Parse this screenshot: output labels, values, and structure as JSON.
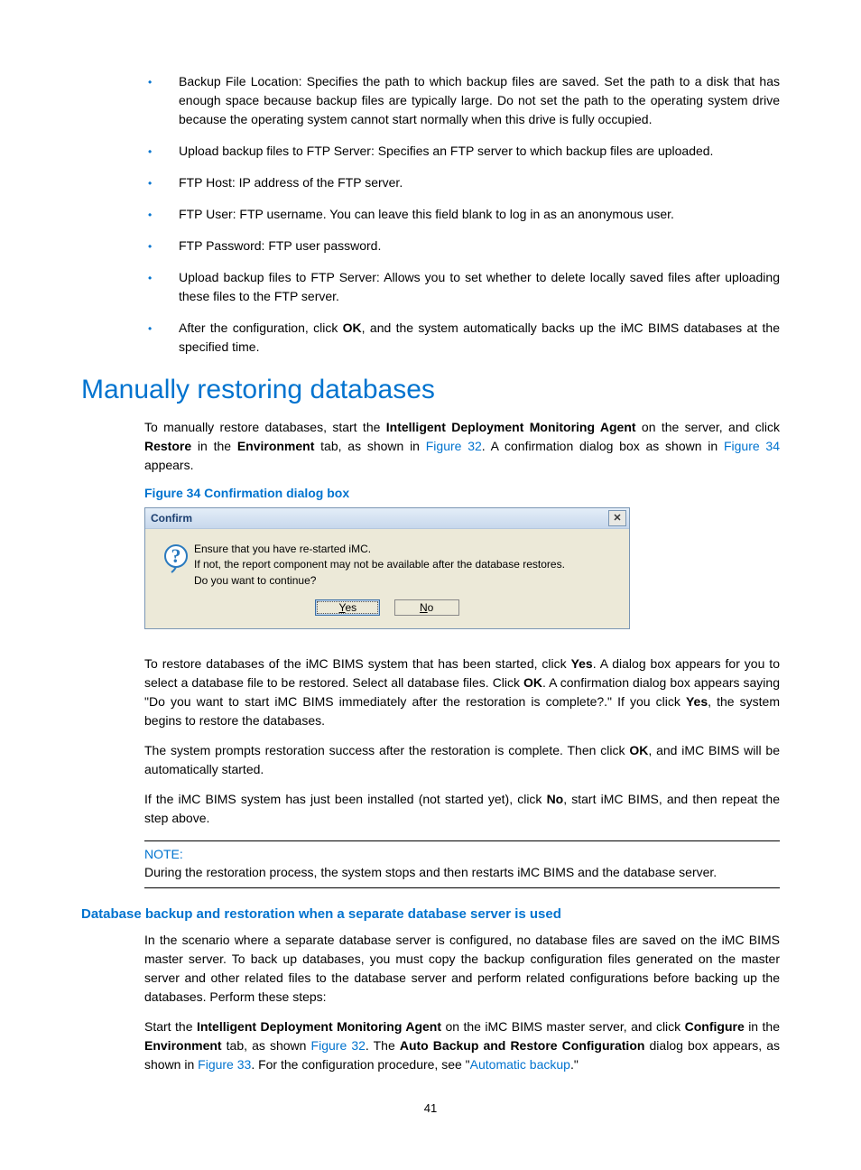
{
  "bullets": [
    "Backup File Location: Specifies the path to which backup files are saved. Set the path to a disk that has enough space because backup files are typically large. Do not set the path to the operating system drive because the operating system cannot start normally when this drive is fully occupied.",
    "Upload backup files to FTP Server: Specifies an FTP server to which backup files are uploaded.",
    "FTP Host: IP address of the FTP server.",
    "FTP User: FTP username. You can leave this field blank to log in as an anonymous user.",
    "FTP Password: FTP user password.",
    "Upload backup files to FTP Server: Allows you to set whether to delete locally saved files after uploading these files to the FTP server."
  ],
  "bullet_last": {
    "pre": "After the configuration, click ",
    "bold": "OK",
    "post": ", and the system automatically backs up the iMC BIMS databases at the specified time."
  },
  "h1": "Manually restoring databases",
  "intro": {
    "pre": "To manually restore databases, start the ",
    "b1": "Intelligent Deployment Monitoring Agent",
    "mid1": " on the server, and click ",
    "b2": "Restore",
    "mid2": " in the ",
    "b3": "Environment",
    "mid3": " tab, as shown in ",
    "link1": "Figure 32",
    "mid4": ". A confirmation dialog box as shown in ",
    "link2": "Figure 34",
    "post": " appears."
  },
  "fig_caption": "Figure 34 Confirmation dialog box",
  "dialog": {
    "title": "Confirm",
    "msg_line1": "Ensure that you have re-started iMC.",
    "msg_line2": "If not, the report component may not be available after the database restores.",
    "msg_line3": "Do you want to continue?",
    "yes_u": "Y",
    "yes_rest": "es",
    "no_u": "N",
    "no_rest": "o"
  },
  "para2": {
    "t1": "To restore databases of the iMC BIMS system that has been started, click ",
    "b1": "Yes",
    "t2": ". A dialog box appears for you to select a database file to be restored. Select all database files. Click ",
    "b2": "OK",
    "t3": ". A confirmation dialog box appears saying \"Do you want to start iMC BIMS immediately after the restoration is complete?.\" If you click ",
    "b3": "Yes",
    "t4": ", the system begins to restore the databases."
  },
  "para3": {
    "t1": "The system prompts restoration success after the restoration is complete. Then click ",
    "b1": "OK",
    "t2": ", and iMC BIMS will be automatically started."
  },
  "para4": {
    "t1": "If the iMC BIMS system has just been installed (not started yet), click ",
    "b1": "No",
    "t2": ", start iMC BIMS, and then repeat the step above."
  },
  "note": {
    "label": "NOTE:",
    "text": "During the restoration process, the system stops and then restarts iMC BIMS and the database server."
  },
  "sub_h": "Database backup and restoration when a separate database server is used",
  "para5": "In the scenario where a separate database server is configured, no database files are saved on the iMC BIMS master server. To back up databases, you must copy the backup configuration files generated on the master server and other related files to the database server and perform related configurations before backing up the databases. Perform these steps:",
  "para6": {
    "t1": "Start the ",
    "b1": "Intelligent Deployment Monitoring Agent",
    "t2": " on the iMC BIMS master server, and click ",
    "b2": "Configure",
    "t3": " in the ",
    "b3": "Environment",
    "t4": " tab, as shown ",
    "l1": "Figure 32",
    "t5": ". The ",
    "b4": "Auto Backup and Restore Configuration",
    "t6": " dialog box appears, as shown in ",
    "l2": "Figure 33",
    "t7": ". For the configuration procedure, see \"",
    "l3": "Automatic backup",
    "t8": ".\""
  },
  "page_num": "41"
}
